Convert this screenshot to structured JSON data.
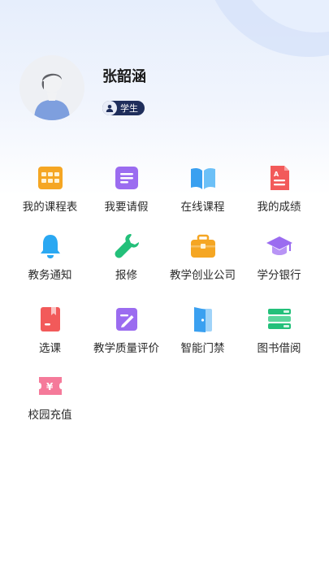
{
  "user": {
    "name": "张韶涵",
    "role": "学生"
  },
  "menu": [
    {
      "label": "我的课程表",
      "icon": "calendar-icon",
      "color": "#f5a623"
    },
    {
      "label": "我要请假",
      "icon": "leave-request-icon",
      "color": "#9b6cf0"
    },
    {
      "label": "在线课程",
      "icon": "book-open-icon",
      "color": "#3aa0f0"
    },
    {
      "label": "我的成绩",
      "icon": "grade-report-icon",
      "color": "#f25a5a"
    },
    {
      "label": "教务通知",
      "icon": "bell-icon",
      "color": "#2aa8f2"
    },
    {
      "label": "报修",
      "icon": "wrench-icon",
      "color": "#23c07a"
    },
    {
      "label": "教学创业公司",
      "icon": "briefcase-icon",
      "color": "#f5a623"
    },
    {
      "label": "学分银行",
      "icon": "graduation-cap-icon",
      "color": "#9b6cf0"
    },
    {
      "label": "选课",
      "icon": "course-book-icon",
      "color": "#f25a5a"
    },
    {
      "label": "教学质量评价",
      "icon": "evaluation-icon",
      "color": "#9b6cf0"
    },
    {
      "label": "智能门禁",
      "icon": "door-icon",
      "color": "#3aa0f0"
    },
    {
      "label": "图书借阅",
      "icon": "books-stack-icon",
      "color": "#23c07a"
    },
    {
      "label": "校园充值",
      "icon": "yuan-ticket-icon",
      "color": "#f57a9a"
    }
  ]
}
